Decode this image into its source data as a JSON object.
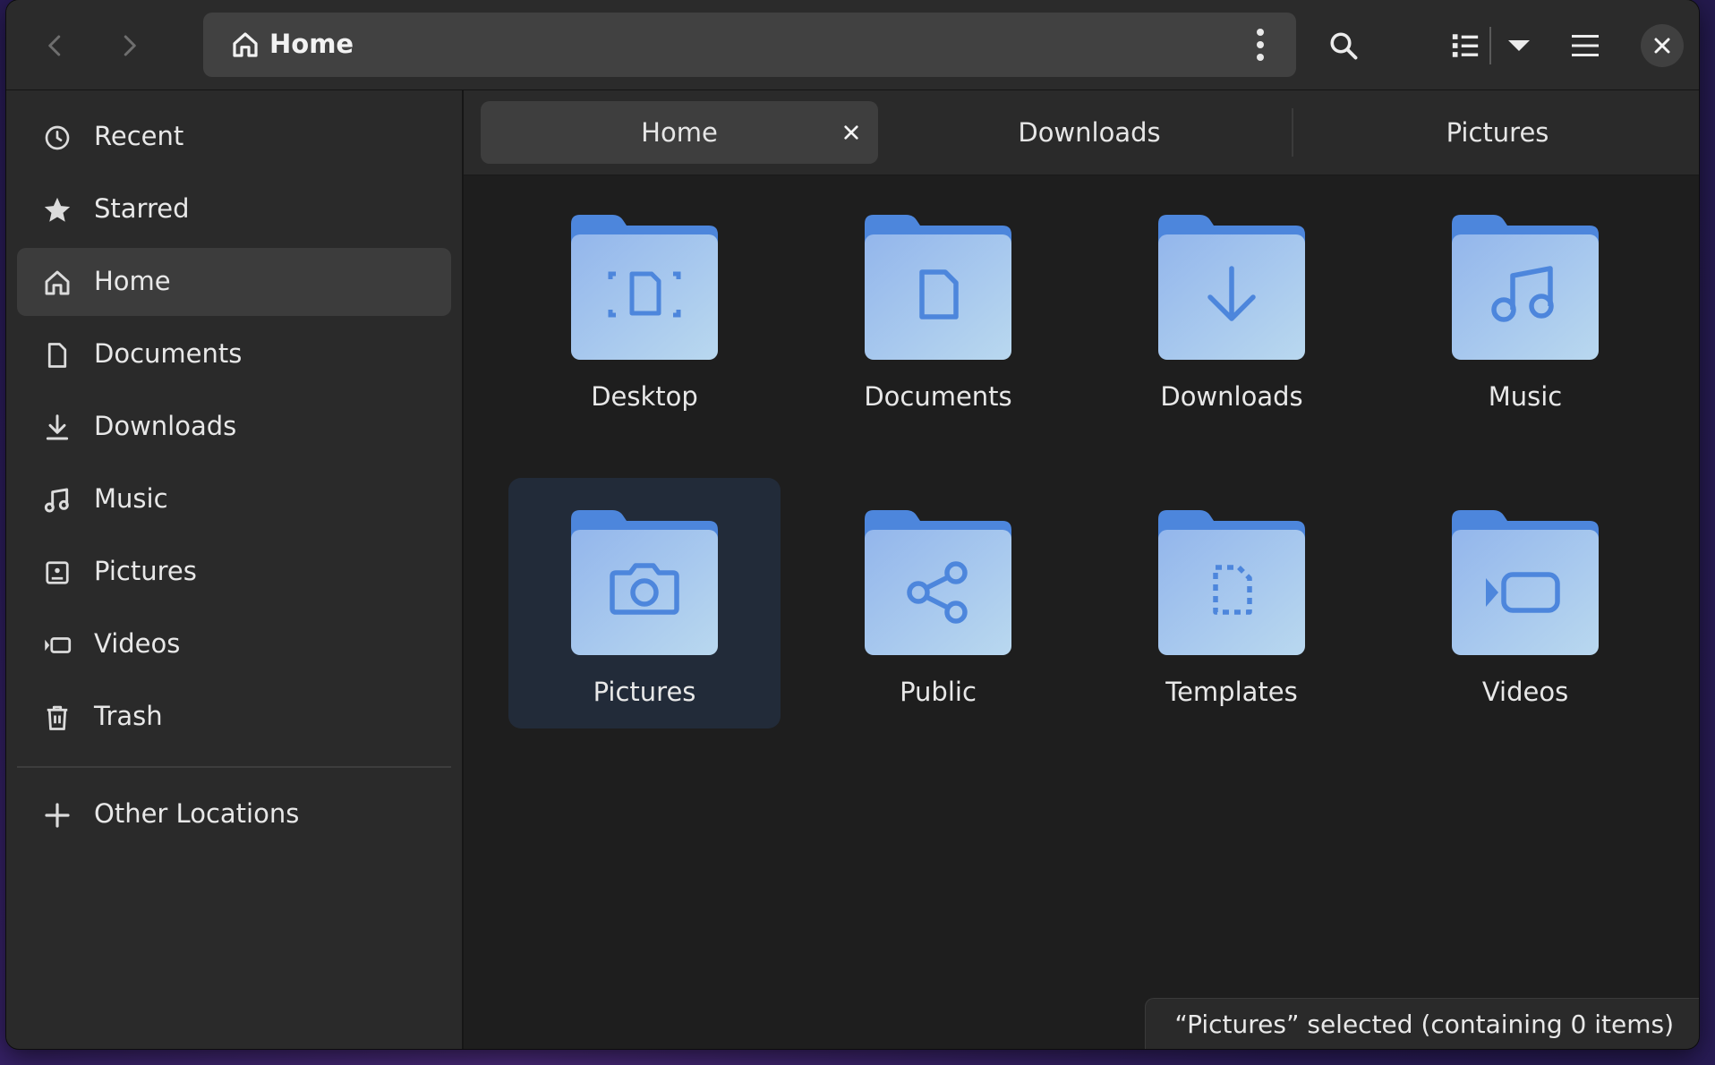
{
  "window": {
    "title": "Home"
  },
  "header": {
    "path_label": "Home",
    "back_icon": "chevron-left-icon",
    "forward_icon": "chevron-right-icon",
    "search_icon": "search-icon",
    "view_icon": "list-view-icon",
    "menu_icon": "hamburger-menu-icon",
    "close_icon": "close-icon"
  },
  "sidebar": {
    "items": [
      {
        "label": "Recent",
        "icon": "clock-icon"
      },
      {
        "label": "Starred",
        "icon": "star-icon"
      },
      {
        "label": "Home",
        "icon": "home-icon",
        "active": true
      },
      {
        "label": "Documents",
        "icon": "document-icon"
      },
      {
        "label": "Downloads",
        "icon": "download-icon"
      },
      {
        "label": "Music",
        "icon": "music-icon"
      },
      {
        "label": "Pictures",
        "icon": "picture-icon"
      },
      {
        "label": "Videos",
        "icon": "video-icon"
      },
      {
        "label": "Trash",
        "icon": "trash-icon"
      }
    ],
    "other_locations": {
      "label": "Other Locations",
      "icon": "plus-icon"
    }
  },
  "tabs": [
    {
      "label": "Home",
      "active": true
    },
    {
      "label": "Downloads"
    },
    {
      "label": "Pictures"
    }
  ],
  "files": [
    {
      "label": "Desktop",
      "emblem": "desktop-emblem"
    },
    {
      "label": "Documents",
      "emblem": "document-emblem"
    },
    {
      "label": "Downloads",
      "emblem": "download-emblem"
    },
    {
      "label": "Music",
      "emblem": "music-emblem"
    },
    {
      "label": "Pictures",
      "emblem": "camera-emblem",
      "selected": true
    },
    {
      "label": "Public",
      "emblem": "share-emblem"
    },
    {
      "label": "Templates",
      "emblem": "template-emblem"
    },
    {
      "label": "Videos",
      "emblem": "video-emblem"
    }
  ],
  "status": {
    "text": "“Pictures” selected  (containing 0 items)"
  },
  "colors": {
    "folder_top": "#4d86dc",
    "folder_body_start": "#93b6ec",
    "folder_body_end": "#b6d4f0",
    "emblem": "#4d86dc",
    "selection": "#222b39"
  }
}
